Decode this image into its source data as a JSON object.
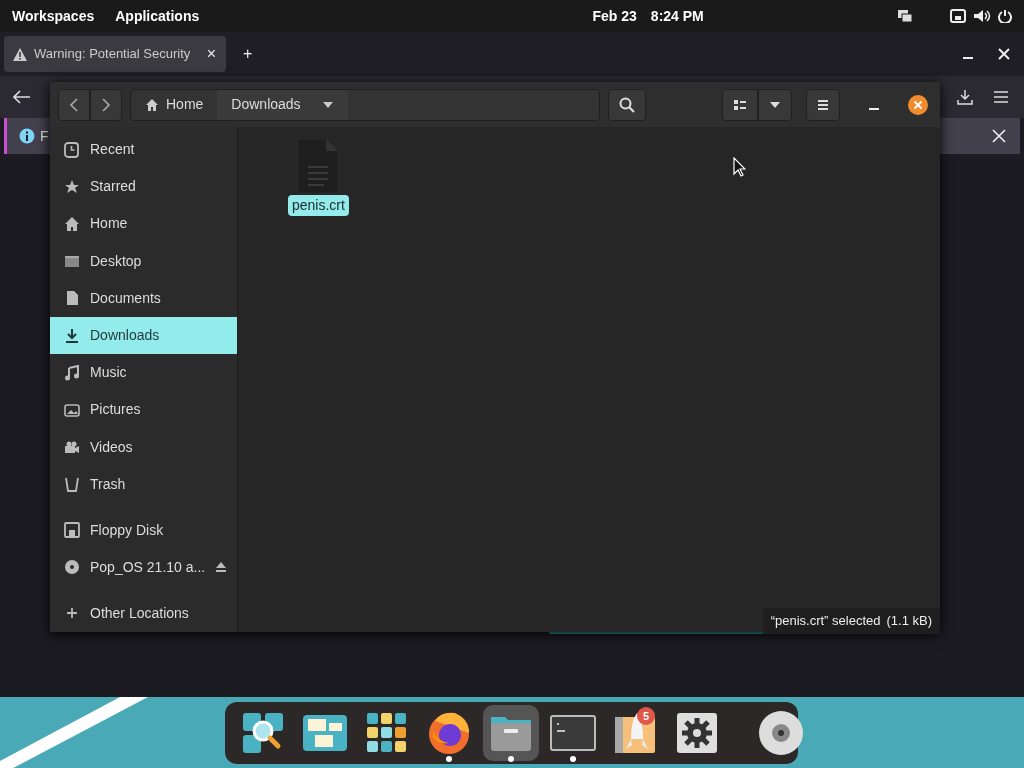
{
  "top_bar": {
    "workspaces": "Workspaces",
    "applications": "Applications",
    "date": "Feb 23",
    "time": "8:24 PM"
  },
  "browser": {
    "tabs": [
      {
        "title": "Warning: Potential Security",
        "selected": true,
        "close": "×"
      }
    ],
    "new_tab": "+",
    "notification": {
      "text": "F"
    }
  },
  "file_manager": {
    "path": [
      {
        "label": "Home",
        "kind": "home"
      },
      {
        "label": "Downloads",
        "kind": "current"
      }
    ],
    "sidebar": [
      [
        {
          "label": "Recent",
          "kind": "recent",
          "selected": false
        },
        {
          "label": "Starred",
          "kind": "star",
          "selected": false
        },
        {
          "label": "Home",
          "kind": "home",
          "selected": false
        },
        {
          "label": "Desktop",
          "kind": "desktop",
          "selected": false
        },
        {
          "label": "Documents",
          "kind": "document",
          "selected": false
        },
        {
          "label": "Downloads",
          "kind": "download",
          "selected": true
        },
        {
          "label": "Music",
          "kind": "music",
          "selected": false
        },
        {
          "label": "Pictures",
          "kind": "picture",
          "selected": false
        },
        {
          "label": "Videos",
          "kind": "video",
          "selected": false
        },
        {
          "label": "Trash",
          "kind": "trash",
          "selected": false
        }
      ],
      [
        {
          "label": "Floppy Disk",
          "kind": "floppy",
          "selected": false
        },
        {
          "label": "Pop_OS 21.10 a...",
          "kind": "disc",
          "selected": false,
          "ejectable": true
        }
      ],
      [
        {
          "label": "Other Locations",
          "kind": "plus",
          "selected": false
        }
      ]
    ],
    "files": [
      {
        "name": "penis.crt",
        "selected": true
      }
    ],
    "status": {
      "text": "“penis.crt” selected",
      "size": "(1.1 kB)"
    }
  },
  "dock": {
    "items": [
      {
        "kind": "search",
        "running": false,
        "active": false
      },
      {
        "kind": "workspaces",
        "running": false,
        "active": false
      },
      {
        "kind": "apps",
        "running": false,
        "active": false
      },
      {
        "kind": "firefox",
        "running": true,
        "active": false
      },
      {
        "kind": "files",
        "running": true,
        "active": true
      },
      {
        "kind": "terminal",
        "running": true,
        "active": false
      },
      {
        "kind": "rocket",
        "running": false,
        "active": false,
        "badge": "5"
      },
      {
        "kind": "settings",
        "running": false,
        "active": false
      },
      {
        "kind": "disc",
        "running": false,
        "active": false
      }
    ]
  }
}
